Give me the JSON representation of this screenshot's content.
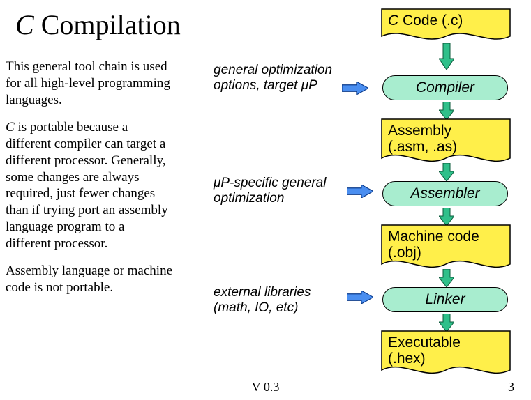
{
  "title_prefix": "C",
  "title_rest": " Compilation",
  "para1": "This general tool chain is used for all high-level programming languages.",
  "para2_lead": "C",
  "para2_rest": " is portable because a different compiler can target a different processor. Generally, some changes are always required, just fewer changes than if trying port an assembly language program to a different processor.",
  "para3": "Assembly language or machine code is not portable.",
  "footer_version": "V 0.3",
  "footer_page": "3",
  "boxes": {
    "ccode_prefix": "C",
    "ccode_rest": " Code (.c)",
    "compiler": "Compiler",
    "assembly_l1": "Assembly",
    "assembly_l2": "(.asm, .as)",
    "assembler": "Assembler",
    "machine_l1": "Machine code",
    "machine_l2": "(.obj)",
    "linker": "Linker",
    "exec_l1": "Executable",
    "exec_l2": "(.hex)"
  },
  "annots": {
    "a1_l1": "general optimization",
    "a1_l2a": "options, target ",
    "a1_l2b": "μP",
    "a2_l1a": "μP",
    "a2_l1b": "-specific general",
    "a2_l2": "optimization",
    "a3_l1": "external libraries",
    "a3_l2": "(math, IO, etc)"
  }
}
